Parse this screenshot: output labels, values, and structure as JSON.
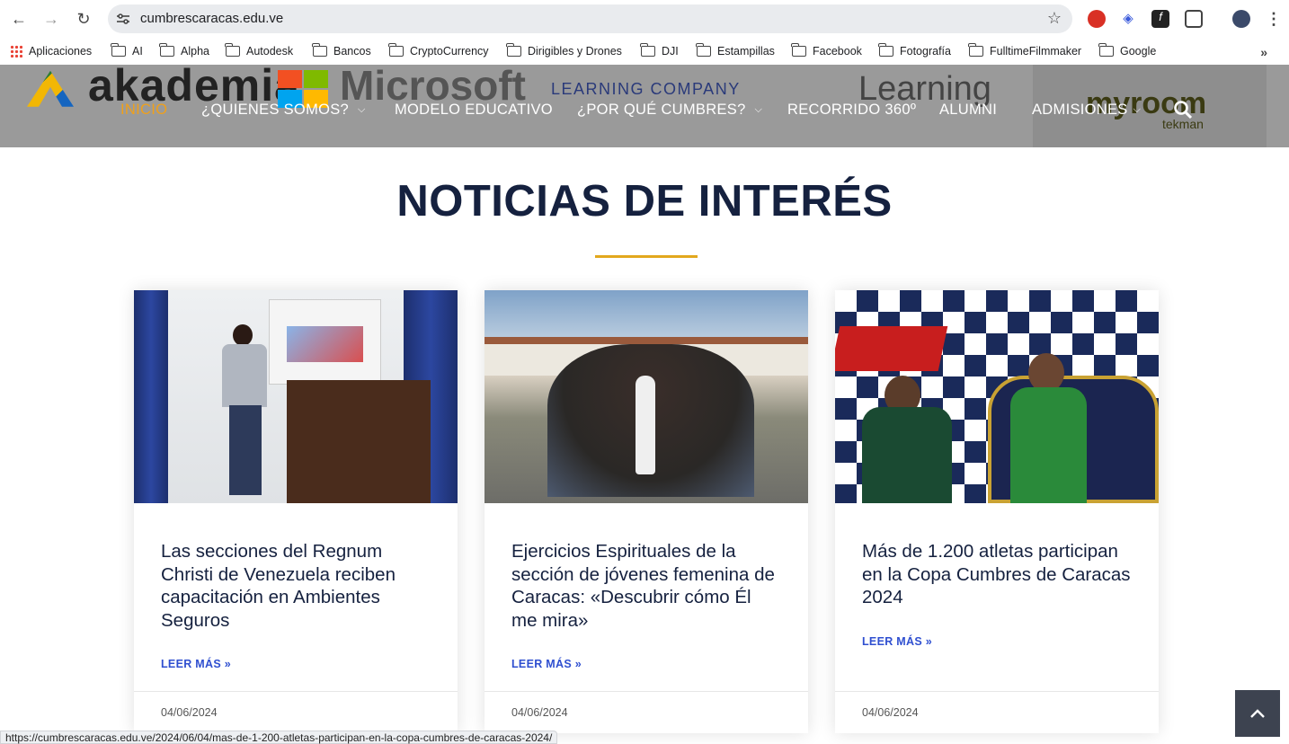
{
  "browser": {
    "url": "cumbrescaracas.edu.ve",
    "bookmarks": [
      "Aplicaciones",
      "AI",
      "Alpha",
      "Autodesk",
      "Bancos",
      "CryptoCurrency",
      "Dirigibles y Drones",
      "DJI",
      "Estampillas",
      "Facebook",
      "Fotografía",
      "FulltimeFilmmaker",
      "Google"
    ],
    "status_url": "https://cumbrescaracas.edu.ve/2024/06/04/mas-de-1-200-atletas-participan-en-la-copa-cumbres-de-caracas-2024/"
  },
  "header": {
    "partner_logos": {
      "akademia": "akademia",
      "microsoft": "Microsoft",
      "learning_company": "LEARNING COMPANY",
      "learning": "Learning",
      "myroom": "myroom",
      "tekman": "tekman"
    },
    "menu": [
      {
        "label": "INICIO",
        "active": true,
        "dropdown": false
      },
      {
        "label": "¿QUIENES SOMOS?",
        "active": false,
        "dropdown": true
      },
      {
        "label": "MODELO EDUCATIVO",
        "active": false,
        "dropdown": false
      },
      {
        "label": "¿POR QUÉ CUMBRES?",
        "active": false,
        "dropdown": true
      },
      {
        "label": "RECORRIDO 360º",
        "active": false,
        "dropdown": false
      },
      {
        "label": "ALUMNI",
        "active": false,
        "dropdown": false
      },
      {
        "label": "ADMISIONES",
        "active": false,
        "dropdown": true
      }
    ]
  },
  "section": {
    "title": "NOTICIAS DE INTERÉS"
  },
  "news": [
    {
      "headline": "Las secciones del Regnum Christi de Venezuela reciben capacitación en Ambientes Seguros",
      "more": "LEER MÁS »",
      "date": "04/06/2024"
    },
    {
      "headline": "Ejercicios Espirituales de la sección de jóvenes femenina de Caracas: «Descubrir cómo Él me mira»",
      "more": "LEER MÁS »",
      "date": "04/06/2024"
    },
    {
      "headline": "Más de 1.200 atletas participan en la Copa Cumbres de Caracas 2024",
      "more": "LEER MÁS »",
      "date": "04/06/2024"
    }
  ],
  "colors": {
    "accent": "#f0a01a",
    "navy": "#15213f",
    "link": "#2f4fd0",
    "rule": "#e2a81d"
  }
}
